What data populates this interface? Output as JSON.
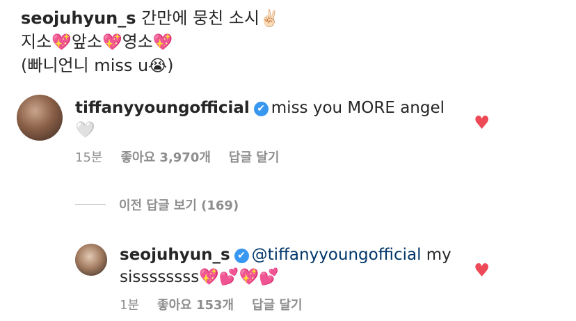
{
  "caption": {
    "username": "seojuhyun_s",
    "line1_text": "간만에 뭉친 소시",
    "line1_emoji": "✌🏻",
    "line2": [
      {
        "text": "지소",
        "emoji": "💖"
      },
      {
        "text": "앞소",
        "emoji": "💖"
      },
      {
        "text": "영소",
        "emoji": "💖"
      }
    ],
    "line3_prefix": "(빠니언니 miss u",
    "line3_emoji": "😭",
    "line3_suffix": ")"
  },
  "comment1": {
    "username": "tiffanyyoungofficial",
    "verified_icon": "✔",
    "text": "miss you MORE angel",
    "trailing_emoji": "🤍",
    "time": "15분",
    "likes": "좋아요 3,970개",
    "reply": "답글 달기",
    "heart_icon": "♥"
  },
  "view_previous_replies": "이전 답글 보기 (169)",
  "reply1": {
    "username": "seojuhyun_s",
    "verified_icon": "✔",
    "mention": "@tiffanyyoungofficial",
    "text_tail": " my",
    "text_line2": "sissssssss",
    "trailing_emojis": "💖💕💖💕",
    "time": "1분",
    "likes": "좋아요 153개",
    "reply": "답글 달기",
    "heart_icon": "♥"
  },
  "colors": {
    "text": "#262626",
    "meta": "#8e8e8e",
    "verified": "#3897f0",
    "heart": "#ed4956",
    "mention": "#003569"
  }
}
